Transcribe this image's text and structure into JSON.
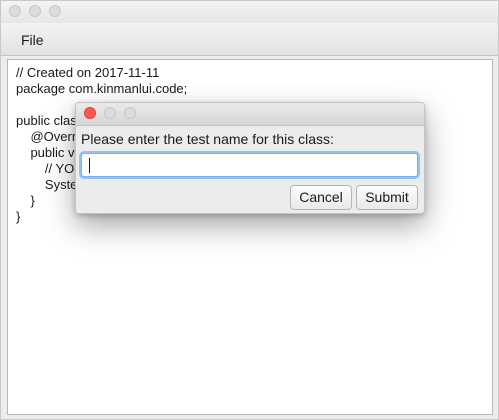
{
  "window": {
    "controls": [
      "close-icon",
      "minimize-icon",
      "zoom-icon"
    ]
  },
  "menu": {
    "items": [
      {
        "label": "File"
      }
    ]
  },
  "editor": {
    "lines": [
      "// Created on 2017-11-11",
      "package com.kinmanlui.code;",
      "",
      "public class",
      "    @Overr",
      "    public v",
      "        // YO",
      "        Syste",
      "    }",
      "}"
    ]
  },
  "dialog": {
    "controls": [
      "close-icon",
      "minimize-icon",
      "zoom-icon"
    ],
    "prompt": "Please enter the test name for this class:",
    "input_value": "",
    "input_placeholder": "",
    "cancel_label": "Cancel",
    "submit_label": "Submit",
    "close_color": "#fc5753",
    "focus_color": "#8fc3f5"
  }
}
